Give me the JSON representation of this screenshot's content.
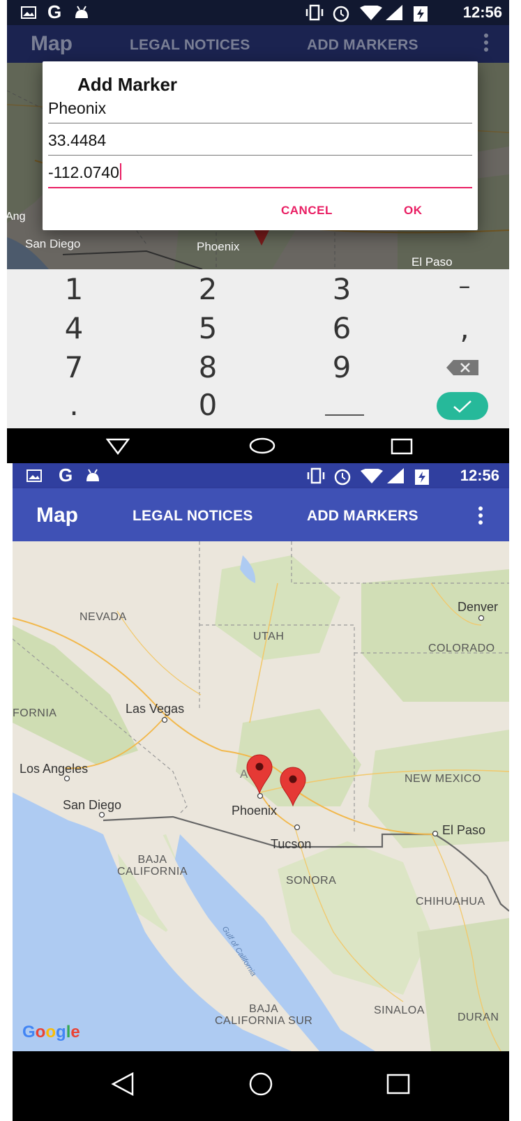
{
  "status": {
    "time": "12:56"
  },
  "appbar": {
    "title": "Map",
    "legal_notices": "LEGAL NOTICES",
    "add_markers": "ADD MARKERS"
  },
  "dialog": {
    "title": "Add Marker",
    "name_value": "Pheonix",
    "lat_value": "33.4484",
    "lng_value": "-112.0740",
    "cancel_label": "CANCEL",
    "ok_label": "OK"
  },
  "keypad": {
    "row1": [
      "1",
      "2",
      "3",
      "–"
    ],
    "row2": [
      "4",
      "5",
      "6",
      ","
    ],
    "row3": [
      "7",
      "8",
      "9"
    ],
    "row4": [
      ".",
      "0"
    ]
  },
  "map_top_labels": {
    "ang": "Ang",
    "san_diego": "San Diego",
    "phoenix": "Phoenix",
    "el_paso": "El Paso"
  },
  "map_labels": {
    "nevada": "NEVADA",
    "utah": "UTAH",
    "colorado": "COLORADO",
    "denver": "Denver",
    "fornia": "FORNIA",
    "las_vegas": "Las Vegas",
    "los_angeles": "Los Angeles",
    "san_diego": "San Diego",
    "phoenix": "Phoenix",
    "tucson": "Tucson",
    "new_mexico": "NEW MEXICO",
    "el_paso": "El Paso",
    "baja_california": "BAJA\nCALIFORNIA",
    "sonora": "SONORA",
    "chihuahua": "CHIHUAHUA",
    "gulf": "Gulf of California",
    "baja_california_sur": "BAJA\nCALIFORNIA SUR",
    "sinaloa": "SINALOA",
    "duran": "DURAN",
    "az": "A"
  },
  "google_logo": [
    "G",
    "o",
    "o",
    "g",
    "l",
    "e"
  ],
  "colors": {
    "primary": "#3F51B5",
    "accent": "#E91E63",
    "keypad_done": "#26B99A",
    "marker": "#E53935"
  }
}
